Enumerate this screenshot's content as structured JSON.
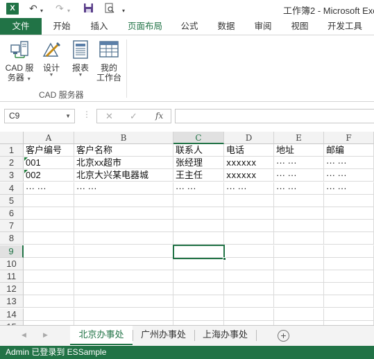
{
  "titlebar": {
    "app_icon": "X",
    "title": "工作簿2 - Microsoft Exc",
    "icons": [
      "excel-icon",
      "undo-icon",
      "redo-icon",
      "save-icon",
      "print-preview-icon",
      "customize-qat-icon"
    ]
  },
  "ribbon_tabs": [
    "文件",
    "开始",
    "插入",
    "页面布局",
    "公式",
    "数据",
    "审阅",
    "视图",
    "开发工具"
  ],
  "ribbon_active_tab": "页面布局",
  "ribbon": {
    "group_label": "CAD 服务器",
    "buttons": [
      {
        "line1": "CAD 服",
        "line2": "务器",
        "icon": "cad-server-icon",
        "dropdown": true
      },
      {
        "line1": "设计",
        "line2": "",
        "icon": "design-icon",
        "dropdown": true
      },
      {
        "line1": "报表",
        "line2": "",
        "icon": "report-icon",
        "dropdown": true
      },
      {
        "line1": "我的",
        "line2": "工作台",
        "icon": "workbench-icon",
        "dropdown": false
      }
    ]
  },
  "formula_bar": {
    "name_box": "C9",
    "cancel_symbol": "✕",
    "enter_symbol": "✓",
    "fx_symbol": "fx",
    "formula": ""
  },
  "grid": {
    "columns": [
      "A",
      "B",
      "C",
      "D",
      "E",
      "F"
    ],
    "rows": [
      "1",
      "2",
      "3",
      "4",
      "5",
      "6",
      "7",
      "8",
      "9",
      "10",
      "11",
      "12",
      "13",
      "14",
      "15"
    ],
    "selected_cell": "C9",
    "cells": {
      "A1": "客户编号",
      "B1": "客户名称",
      "C1": "联系人",
      "D1": "电话",
      "E1": "地址",
      "F1": "邮编",
      "A2": "001",
      "B2": "北京xx超市",
      "C2": "张经理",
      "D2": "xxxxxx",
      "E2": "··· ···",
      "F2": "··· ···",
      "A3": "002",
      "B3": "北京大兴某电器城",
      "C3": "王主任",
      "D3": "xxxxxx",
      "E3": "··· ···",
      "F3": "··· ···",
      "A4": "··· ···",
      "B4": "··· ···",
      "C4": "··· ···",
      "D4": "··· ···",
      "E4": "··· ···",
      "F4": "··· ···"
    }
  },
  "sheet_tabs": [
    "北京办事处",
    "广州办事处",
    "上海办事处"
  ],
  "active_sheet": "北京办事处",
  "add_sheet_symbol": "+",
  "status_bar": {
    "text": "Admin 已登录到 ESSample"
  },
  "colors": {
    "accent": "#217346",
    "status_bar": "#217346"
  }
}
